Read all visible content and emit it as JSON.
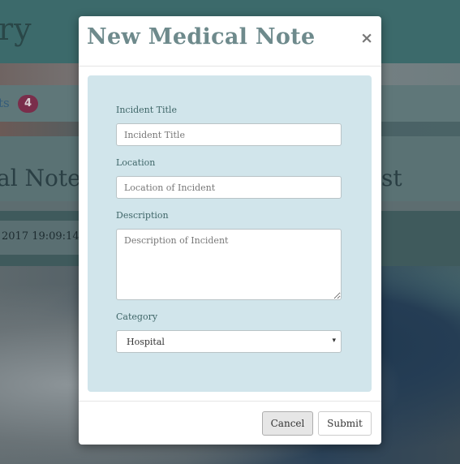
{
  "background": {
    "header_title": "ry",
    "nav_link_text": "ts",
    "nav_badge_count": "4",
    "panel_title": "al Notes",
    "panel_title_right": "st",
    "date_text": "2017 19:09:14 GM"
  },
  "modal": {
    "title": "New Medical Note",
    "close_label": "×",
    "fields": {
      "incident_title": {
        "label": "Incident Title",
        "placeholder": "Incident Title",
        "value": ""
      },
      "location": {
        "label": "Location",
        "placeholder": "Location of Incident",
        "value": ""
      },
      "description": {
        "label": "Description",
        "placeholder": "Description of Incident",
        "value": ""
      },
      "category": {
        "label": "Category",
        "selected": "Hospital",
        "arrow_icon": "▾"
      }
    },
    "buttons": {
      "cancel_label": "Cancel",
      "submit_label": "Submit"
    }
  },
  "colors": {
    "modal_body_bg": "#d1e5eb",
    "title_color": "#6e8a8c",
    "label_color": "#3f6668",
    "backdrop": "#3f5a5c"
  }
}
